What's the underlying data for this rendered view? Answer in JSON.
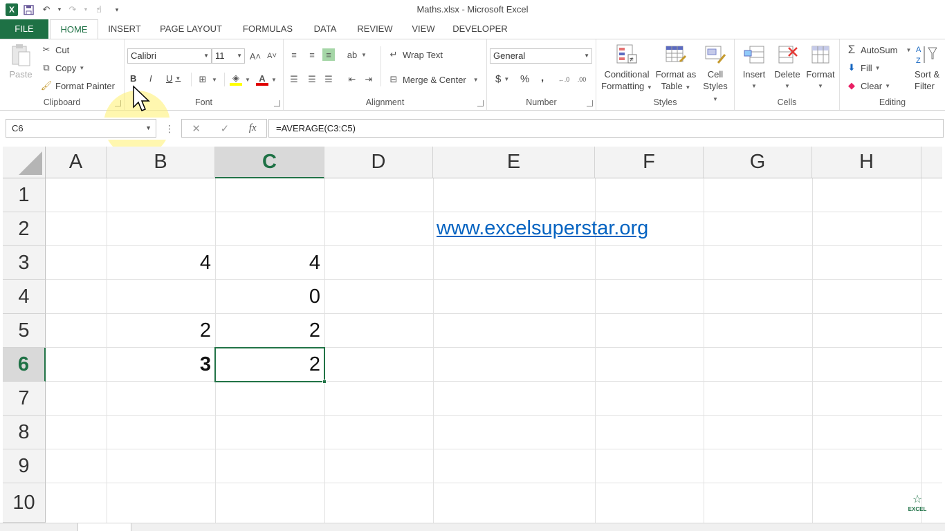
{
  "window": {
    "title": "Maths.xlsx - Microsoft Excel"
  },
  "qat": {
    "excel_icon": "X"
  },
  "tabs": [
    "FILE",
    "HOME",
    "INSERT",
    "PAGE LAYOUT",
    "FORMULAS",
    "DATA",
    "REVIEW",
    "VIEW",
    "DEVELOPER"
  ],
  "ribbon": {
    "clipboard": {
      "paste": "Paste",
      "cut": "Cut",
      "copy": "Copy",
      "format_painter": "Format Painter",
      "label": "Clipboard"
    },
    "font": {
      "name": "Calibri",
      "size": "11",
      "bold": "B",
      "italic": "I",
      "underline": "U",
      "color_letter": "A",
      "label": "Font"
    },
    "alignment": {
      "wrap_text": "Wrap Text",
      "merge_center": "Merge & Center",
      "label": "Alignment"
    },
    "number": {
      "format": "General",
      "currency": "$",
      "percent": "%",
      "comma": ",",
      "label": "Number"
    },
    "styles": {
      "conditional_1": "Conditional",
      "conditional_2": "Formatting",
      "format_as_1": "Format as",
      "format_as_2": "Table",
      "cell_1": "Cell",
      "cell_2": "Styles",
      "label": "Styles"
    },
    "cells": {
      "insert": "Insert",
      "delete": "Delete",
      "format": "Format",
      "label": "Cells"
    },
    "editing": {
      "autosum": "AutoSum",
      "fill": "Fill",
      "clear": "Clear",
      "sort_1": "Sort &",
      "sort_2": "Filter",
      "label": "Editing"
    }
  },
  "formula_bar": {
    "name_box": "C6",
    "cancel": "✕",
    "enter": "✓",
    "fx": "fx",
    "formula": "=AVERAGE(C3:C5)"
  },
  "grid": {
    "columns": [
      "A",
      "B",
      "C",
      "D",
      "E",
      "F",
      "G",
      "H"
    ],
    "rows": [
      "1",
      "2",
      "3",
      "4",
      "5",
      "6",
      "7",
      "8",
      "9",
      "10"
    ],
    "cells": {
      "B3": "4",
      "C3": "4",
      "C4": "0",
      "B5": "2",
      "C5": "2",
      "B6": "3",
      "C6": "2",
      "E2": "www.excelsuperstar.org"
    }
  },
  "watermark": {
    "text": "EXCEL"
  }
}
